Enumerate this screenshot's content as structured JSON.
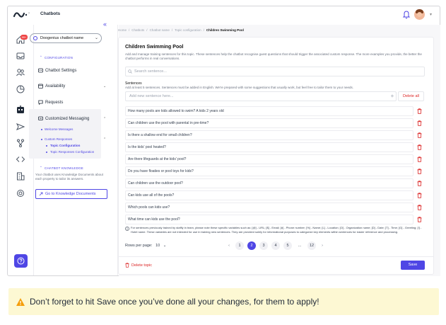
{
  "app": {
    "title": "Chatbots"
  },
  "rail": {
    "badge": "99+"
  },
  "sidebar": {
    "bot_name": "Doogenius chatbot name",
    "configuration_head": "CONFIGURATION",
    "items": [
      {
        "label": "Chatbot Settings",
        "icon": "settings-icon"
      },
      {
        "label": "Availability",
        "icon": "calendar-icon"
      },
      {
        "label": "Requests",
        "icon": "chat-icon"
      },
      {
        "label": "Customized Messaging",
        "icon": "message-icon"
      }
    ],
    "sub_items": [
      {
        "label": "Welcome Messages"
      },
      {
        "label": "Custom Responses"
      },
      {
        "label": "Topic Configuration"
      },
      {
        "label": "Topic Responses Configuration"
      }
    ],
    "knowledge_head": "CHATBOT KNOWLEDGE",
    "knowledge_text": "Your chatbot uses Knowledge Documents about each property to tailor its answers.",
    "knowledge_button": "Go to Knowledge Documents"
  },
  "breadcrumb": [
    "Home",
    "/",
    "Chatbots",
    "/",
    "Chatbot name",
    "/",
    "Topic configuration",
    "/"
  ],
  "breadcrumb_current": "Children Swimming Pool",
  "topic": {
    "title": "Children Swimming Pool",
    "description": "Add and manage training sentences for this topic. These sentences help the chatbot recognise guest questions that should trigger the associated custom response. The more examples you provide, the better the chatbot performs in real conversations.",
    "search_placeholder": "Search sentence...",
    "sentences_label": "Sentences",
    "sentences_desc": "Add at least 5 sentences. Sentences must be added in English. We're prepared with some suggestions that usually work, but feel free to tailor them to your needs.",
    "add_placeholder": "Add new sentence here...",
    "delete_all": "Delete all",
    "sentences": [
      "How many pools are kids allowed to swim? A kids 2 years old",
      "Can children use the pool with parental in pre-time?",
      "Is there a shallow end for small children?",
      "Is the kids' pool heated?",
      "Are there lifeguards at the kids' pool?",
      "Do you have floaties or pool toys for kids?",
      "Can children use the outdoor pool?",
      "Can kids use all of the pools?",
      "Which pools can kids use?",
      "What time can kids use the pool?"
    ],
    "footnote": "For sentences previously trained by staffly in team, please note these specific variables such as: [@] - URL; [$] - Email; [#] - Phone number; [%] - Name; [L] - Location; [O] - Organization name; [D] - Date; [T] - Time; [G] - Greeting; [!] - Hotel name. These variables are not intended for use in training new sentences. They are provided solely for informational purposes to categorize key elements within sentences for easier reference and processing.",
    "rows_per_page": "Rows per page:",
    "rows_value": "10",
    "pages": [
      "1",
      "2",
      "3",
      "4",
      "5",
      "...",
      "12"
    ],
    "active_page": "2",
    "delete_topic": "Delete topic",
    "save": "Save"
  },
  "banner": {
    "text": "Don’t forget to hit Save once you’ve done all your changes, for them to apply!",
    "icon": "warning-icon"
  },
  "colors": {
    "accent": "#4f46e5",
    "danger": "#dc2626",
    "banner": "#fdf8d3",
    "warning": "#f59e0b"
  }
}
